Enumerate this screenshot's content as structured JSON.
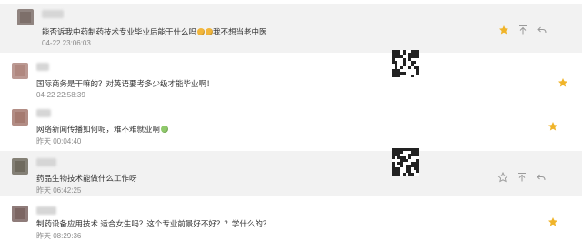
{
  "colors": {
    "star_active": "#f0b429",
    "icon_grey": "#9a9a9a",
    "row_highlight": "#f2f2f2",
    "time_text": "#8a8a8a"
  },
  "messages": [
    {
      "text_before": "能否诉我中药制药技术专业毕业后能干什么吗",
      "emoji": [
        "emoji-face",
        "emoji-face"
      ],
      "text_after": "我不想当老中医",
      "time": "04-22 23:06:03",
      "starred": true,
      "actions": [
        "star-icon",
        "pin-top-icon",
        "reply-icon"
      ]
    },
    {
      "text": "国际商务是干嘛的？对英语要考多少级才能毕业啊！",
      "time": "04-22 22:58:39",
      "starred": true,
      "has_qr": true
    },
    {
      "text": "网络新闻传播如何呢，难不难就业啊",
      "emoji": [
        "emoji-face"
      ],
      "time": "昨天 00:04:40",
      "starred": true
    },
    {
      "text": "药品生物技术能做什么工作呀",
      "time": "昨天 06:42:25",
      "starred": false,
      "has_qr": true,
      "actions": [
        "star-icon",
        "pin-top-icon",
        "reply-icon"
      ]
    },
    {
      "text": "制药设备应用技术   适合女生吗？这个专业前景好不好？？学什么的？",
      "time": "昨天 08:29:36",
      "starred": true
    }
  ]
}
